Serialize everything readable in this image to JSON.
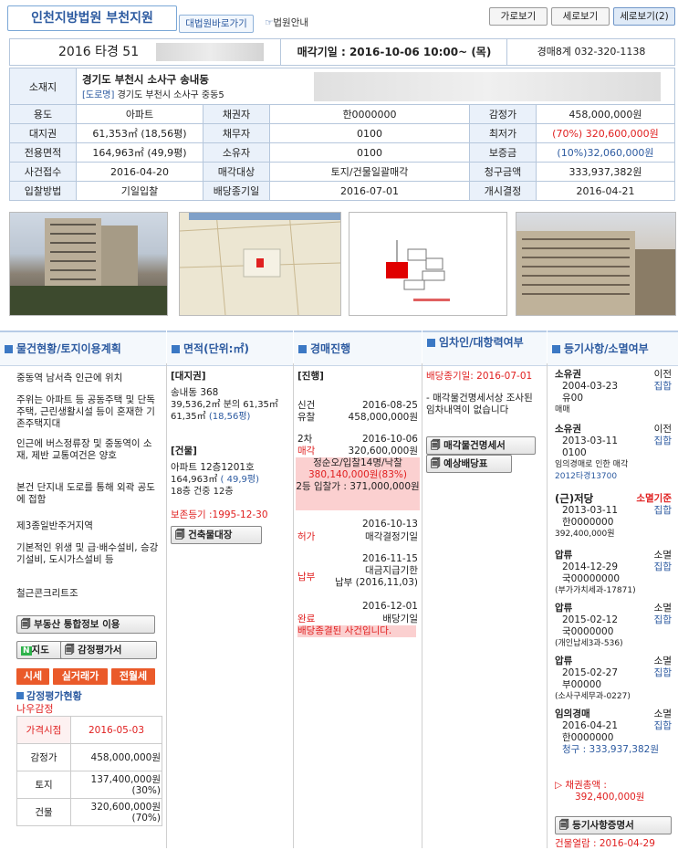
{
  "header": {
    "court_name": "인천지방법원 부천지원",
    "court_link": "대법원바로가기",
    "guide_link": "법원안내",
    "view_buttons": [
      "가로보기",
      "세로보기",
      "세로보기(2)"
    ]
  },
  "case": {
    "case_number": "2016 타경 51",
    "sale_date": "매각기일 : 2016-10-06 10:00~ (목)",
    "dept": "경매8계 032-320-1138"
  },
  "info": {
    "location_label": "소재지",
    "location_main": "경기도 부천시 소사구 송내동",
    "location_road_tag": "[도로명]",
    "location_road": "경기도 부천시 소사구 중동5",
    "rows": [
      [
        "용도",
        "아파트",
        "채권자",
        "한0000000",
        "감정가",
        "458,000,000원"
      ],
      [
        "대지권",
        "61,353㎡ (18,56평)",
        "채무자",
        "0100",
        "최저가",
        "(70%) 320,600,000원"
      ],
      [
        "전용면적",
        "164,963㎡ (49,9평)",
        "소유자",
        "0100",
        "보증금",
        "(10%)32,060,000원"
      ],
      [
        "사건접수",
        "2016-04-20",
        "매각대상",
        "토지/건물일괄매각",
        "청구금액",
        "333,937,382원"
      ],
      [
        "입찰방법",
        "기일입찰",
        "배당종기일",
        "2016-07-01",
        "개시결정",
        "2016-04-21"
      ]
    ]
  },
  "sections": {
    "s1": "물건현황/토지이용계획",
    "s2": "면적(단위:㎡)",
    "s3": "경매진행",
    "s4": "임차인/대항력여부",
    "s5": "등기사항/소멸여부"
  },
  "col1": {
    "lines": [
      "중동역 남서측 인근에 위치",
      "주위는 아파트 등 공동주택 및 단독주택, 근린생활시설 등이 혼재한 기존주택지대",
      "인근에 버스정류장 및 중동역이 소재, 제반 교통여건은 양호",
      "본건 단지내 도로를 통해 외곽 공도에 접함",
      "제3종일반주거지역",
      "기본적인 위생 및 급·배수설비, 승강기설비, 도시가스설비 등",
      "철근콘크리트조"
    ],
    "btn_info": "부동산 통합정보 이용",
    "btn_map": "지도",
    "btn_appraisal": "감정평가서",
    "red_btns": [
      "시세",
      "실거래가",
      "전월세"
    ],
    "appraisal_title": "감정평가현황",
    "appraisal_org": "나우감정",
    "appraisal_rows": [
      [
        "가격시점",
        "2016-05-03"
      ],
      [
        "감정가",
        "458,000,000원"
      ],
      [
        "토지",
        "137,400,000원\n(30%)"
      ],
      [
        "건물",
        "320,600,000원\n(70%)"
      ]
    ]
  },
  "col2": {
    "land_title": "[대지권]",
    "land_l1": "송내동 368",
    "land_l2": "39,536,2㎡ 분의 61,35㎡",
    "land_l3a": "61,35㎡",
    "land_l3b": "(18,56평)",
    "bldg_title": "[건물]",
    "bldg_l1": "아파트 12층1201호",
    "bldg_l2a": "164,963㎡",
    "bldg_l2b": "( 49,9평)",
    "bldg_l3": "18층 건중 12층",
    "preserve": "보존등기 :1995-12-30",
    "bldg_btn": "건축물대장"
  },
  "col3": {
    "title": "[진행]",
    "r1_label": "신건",
    "r1_date": "2016-08-25",
    "r2_label": "유찰",
    "r2_value": "458,000,000원",
    "r3_label": "2차",
    "r3_date": "2016-10-06",
    "r4_label": "매각",
    "r4_value": "320,600,000원",
    "bid_line": "정순오/입찰14명/낙찰",
    "bid_price": "380,140,000원(83%)",
    "second_bid": "2등 입찰가 : 371,000,000원",
    "r5_date": "2016-10-13",
    "r5_label": "허가",
    "r5_value": "매각결정기일",
    "r6_date": "2016-11-15",
    "r6_value": "대금지급기한",
    "r6_label": "납부",
    "r6_value2": "납부 (2016,11,03)",
    "r7_date": "2016-12-01",
    "r7_label": "완료",
    "r7_value": "배당기일",
    "end_note": "배당종결된 사건입니다."
  },
  "col4": {
    "due": "배당종기일: 2016-07-01",
    "note": "- 매각물건명세서상 조사된 임차내역이 없습니다",
    "btn1": "매각물건명세서",
    "btn2": "예상배당표"
  },
  "col5": {
    "entries": [
      {
        "type": "소유권",
        "status": "이전",
        "status2": "집합",
        "date": "2004-03-23",
        "name": "유00",
        "note": "매매"
      },
      {
        "type": "소유권",
        "status": "이전",
        "status2": "집합",
        "date": "2013-03-11",
        "name": "0100",
        "note": "임의경매로 인한 매각",
        "note2": "2012타경13700"
      },
      {
        "type": "(근)저당",
        "status": "소멸기준",
        "status2": "집합",
        "date": "2013-03-11",
        "name": "한0000000",
        "note": "392,400,000원"
      },
      {
        "type": "압류",
        "status": "소멸",
        "status2": "집합",
        "date": "2014-12-29",
        "name": "국00000000",
        "note": "(부가가치세과-17871)"
      },
      {
        "type": "압류",
        "status": "소멸",
        "status2": "집합",
        "date": "2015-02-12",
        "name": "국0000000",
        "note": "(개인납세3과-536)"
      },
      {
        "type": "압류",
        "status": "소멸",
        "status2": "집합",
        "date": "2015-02-27",
        "name": "부00000",
        "note": "(소사구세무과-0227)"
      },
      {
        "type": "임의경매",
        "status": "소멸",
        "status2": "집합",
        "date": "2016-04-21",
        "name": "한0000000",
        "note": "청구 : 333,937,382원"
      }
    ],
    "total_label": "▷ 채권총액 :",
    "total_value": "392,400,000원",
    "btn": "등기사항증명서",
    "view_date": "건물열람 : 2016-04-29"
  }
}
